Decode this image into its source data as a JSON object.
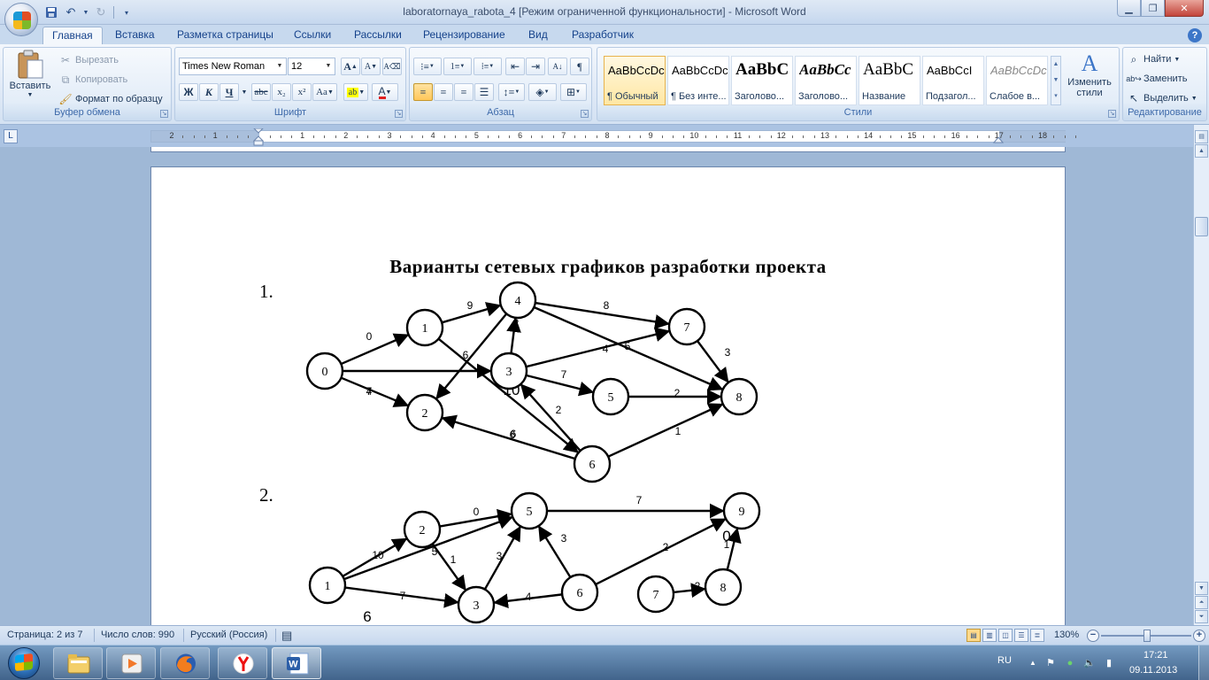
{
  "window": {
    "title": "laboratornaya_rabota_4 [Режим ограниченной функциональности] - Microsoft Word"
  },
  "tabs": [
    {
      "label": "Главная",
      "active": true
    },
    {
      "label": "Вставка"
    },
    {
      "label": "Разметка страницы"
    },
    {
      "label": "Ссылки"
    },
    {
      "label": "Рассылки"
    },
    {
      "label": "Рецензирование"
    },
    {
      "label": "Вид"
    },
    {
      "label": "Разработчик"
    }
  ],
  "ribbon": {
    "clipboard": {
      "label": "Буфер обмена",
      "paste": "Вставить",
      "cut": "Вырезать",
      "copy": "Копировать",
      "format_painter": "Формат по образцу"
    },
    "font": {
      "label": "Шрифт",
      "font_name": "Times New Roman",
      "font_size": "12",
      "bold": "Ж",
      "italic": "К",
      "underline": "Ч",
      "strike": "abc",
      "subscript": "x₂",
      "superscript": "x²",
      "case": "Aa",
      "grow": "A",
      "shrink": "A"
    },
    "paragraph": {
      "label": "Абзац"
    },
    "styles": {
      "label": "Стили",
      "items": [
        {
          "sample": "AaBbCcDc",
          "name": "¶ Обычный",
          "selected": true
        },
        {
          "sample": "AaBbCcDc",
          "name": "¶ Без инте..."
        },
        {
          "sample": "AaBbC",
          "name": "Заголово..."
        },
        {
          "sample": "AaBbCc",
          "name": "Заголово..."
        },
        {
          "sample": "AaBbC",
          "name": "Название"
        },
        {
          "sample": "AaBbCcI",
          "name": "Подзагол..."
        },
        {
          "sample": "AaBbCcDc",
          "name": "Слабое в..."
        }
      ],
      "change_styles": "Изменить стили"
    },
    "editing": {
      "label": "Редактирование",
      "find": "Найти",
      "replace": "Заменить",
      "select": "Выделить"
    }
  },
  "ruler": {
    "labels": [
      "2",
      "1",
      "",
      "1",
      "2",
      "3",
      "4",
      "5",
      "6",
      "7",
      "8",
      "9",
      "10",
      "11",
      "12",
      "13",
      "14",
      "15",
      "16",
      "17",
      "18"
    ]
  },
  "document": {
    "title": "Варианты сетевых графиков разработки проекта",
    "items": [
      "1.",
      "2."
    ],
    "graph1": {
      "nodes": [
        {
          "id": "0"
        },
        {
          "id": "1"
        },
        {
          "id": "2"
        },
        {
          "id": "3"
        },
        {
          "id": "4"
        },
        {
          "id": "5"
        },
        {
          "id": "6"
        },
        {
          "id": "7"
        },
        {
          "id": "8"
        }
      ],
      "edges": [
        {
          "from": "0",
          "to": "1",
          "weight": "0"
        },
        {
          "from": "0",
          "to": "3",
          "weight": "7"
        },
        {
          "from": "0",
          "to": "2",
          "weight": "4"
        },
        {
          "from": "1",
          "to": "4",
          "weight": "9"
        },
        {
          "from": "1",
          "to": "6",
          "weight": "6"
        },
        {
          "from": "4",
          "to": "2",
          "weight": "6"
        },
        {
          "from": "3",
          "to": "4",
          "weight": "2"
        },
        {
          "from": "4",
          "to": "7",
          "weight": "8"
        },
        {
          "from": "4",
          "to": "8",
          "weight": "5"
        },
        {
          "from": "3",
          "to": "7",
          "weight": "4"
        },
        {
          "from": "3",
          "to": "5",
          "weight": "7"
        },
        {
          "from": "5",
          "to": "8",
          "weight": "2"
        },
        {
          "from": "7",
          "to": "8",
          "weight": "3"
        },
        {
          "from": "6",
          "to": "3",
          "weight": "2"
        },
        {
          "from": "6",
          "to": "2",
          "weight": "6"
        },
        {
          "from": "6",
          "to": "8",
          "weight": "1"
        },
        {
          "label_only": "10"
        }
      ]
    },
    "graph2": {
      "nodes": [
        {
          "id": "1"
        },
        {
          "id": "2"
        },
        {
          "id": "3"
        },
        {
          "id": "5"
        },
        {
          "id": "6"
        },
        {
          "id": "7"
        },
        {
          "id": "8"
        },
        {
          "id": "9"
        }
      ],
      "edges": [
        {
          "from": "1",
          "to": "2",
          "weight": "10"
        },
        {
          "from": "1",
          "to": "5",
          "weight": "5"
        },
        {
          "from": "1",
          "to": "3",
          "weight": "7"
        },
        {
          "from": "2",
          "to": "5",
          "weight": "0"
        },
        {
          "from": "2",
          "to": "3",
          "weight": "1"
        },
        {
          "from": "3",
          "to": "5",
          "weight": "3"
        },
        {
          "from": "6",
          "to": "5",
          "weight": "3"
        },
        {
          "from": "6",
          "to": "3",
          "weight": "4"
        },
        {
          "from": "5",
          "to": "9",
          "weight": "7"
        },
        {
          "from": "6",
          "to": "9",
          "weight": "2"
        },
        {
          "from": "7",
          "to": "8",
          "weight": "2"
        },
        {
          "from": "8",
          "to": "9",
          "weight": "1"
        },
        {
          "label_only": "0"
        },
        {
          "label_only": "6"
        }
      ]
    }
  },
  "status": {
    "page": "Страница: 2 из 7",
    "words": "Число слов: 990",
    "language": "Русский (Россия)",
    "zoom": "130%"
  },
  "taskbar": {
    "language": "RU",
    "time": "17:21",
    "date": "09.11.2013"
  },
  "colors": {
    "ribbon_bg": "#dfe9f6",
    "accent": "#15428b",
    "page": "#ffffff",
    "workspace": "#9fb8d6"
  }
}
